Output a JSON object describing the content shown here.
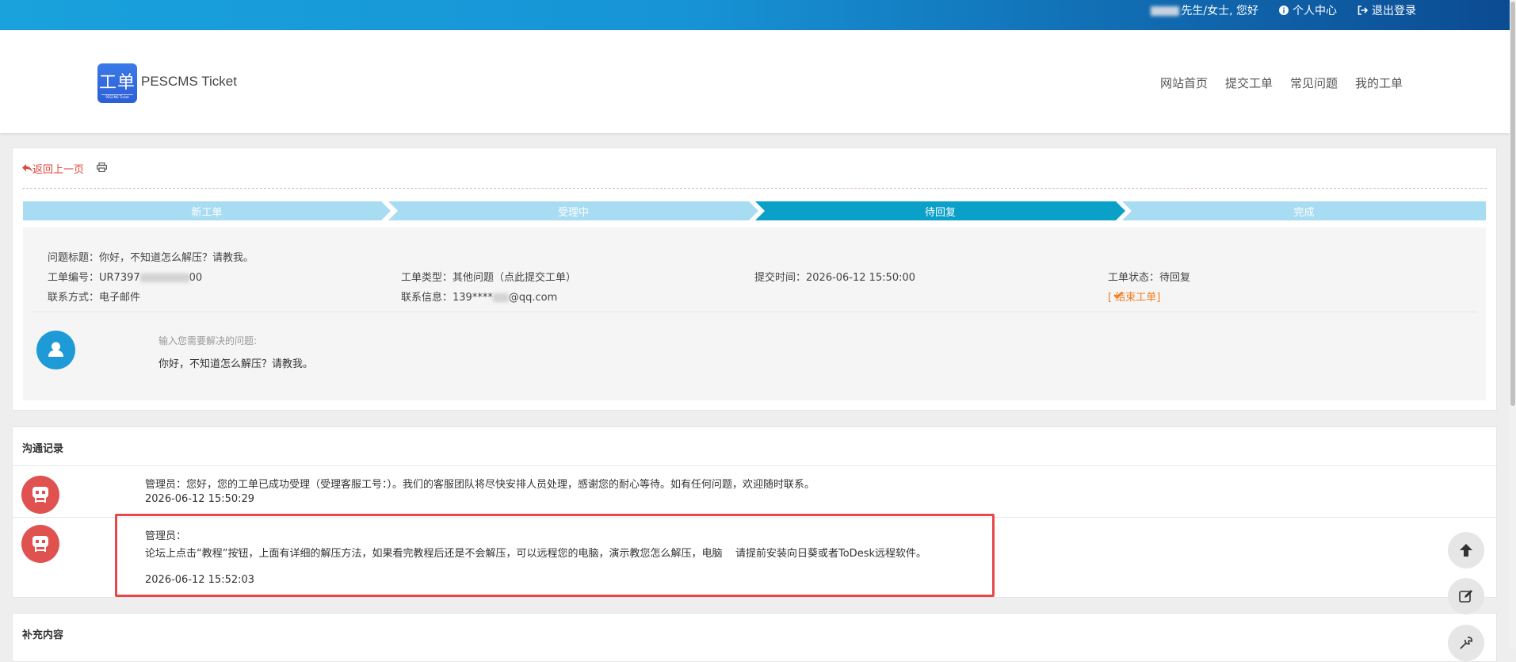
{
  "topbar": {
    "greeting": "先生/女士, 您好",
    "profile_label": "个人中心",
    "logout_label": "退出登录"
  },
  "header": {
    "logo_text": "工单",
    "logo_subtext": "PESCMS Ticket",
    "brand": "PESCMS Ticket",
    "nav": [
      "网站首页",
      "提交工单",
      "常见问题",
      "我的工单"
    ]
  },
  "ticket": {
    "back_label": "返回上一页",
    "steps": [
      "新工单",
      "受理中",
      "待回复",
      "完成"
    ],
    "active_step": 2,
    "title_line": "问题标题：你好，不知道怎么解压？请教我。",
    "number_prefix": "工单编号：UR7397",
    "number_suffix": "00",
    "type_line": "工单类型：其他问题（点此提交工单）",
    "time_line": "提交时间：2026-06-12 15:50:00",
    "status_line": "工单状态：待回复",
    "contact_method": "联系方式：电子邮件",
    "contact_info_prefix": "联系信息：139****",
    "contact_info_suffix": "@qq.com",
    "close_label": "[ 结束工单]",
    "question_label": "输入您需要解决的问题:",
    "question_text": "你好，不知道怎么解压？请教我。"
  },
  "records": {
    "title": "沟通记录",
    "messages": [
      {
        "line1": "管理员：您好，您的工单已成功受理（受理客服工号：）。我们的客服团队将尽快安排人员处理，感谢您的耐心等待。如有任何问题，欢迎随时联系。",
        "time": "2026-06-12 15:50:29"
      },
      {
        "line1": "管理员：",
        "line2": "论坛上点击“教程”按钮，上面有详细的解压方法，如果看完教程后还是不会解压，可以远程您的电脑，演示教您怎么解压，电脑    请提前安装向日葵或者ToDesk远程软件。",
        "time": "2026-06-12 15:52:03"
      }
    ]
  },
  "supplement": {
    "title": "补充内容"
  },
  "colors": {
    "step_light": "#a8dcf2",
    "step_active": "#0aa0c8",
    "accent_red": "#e0463b",
    "accent_orange": "#f37b1d",
    "highlight": "#e84749"
  }
}
